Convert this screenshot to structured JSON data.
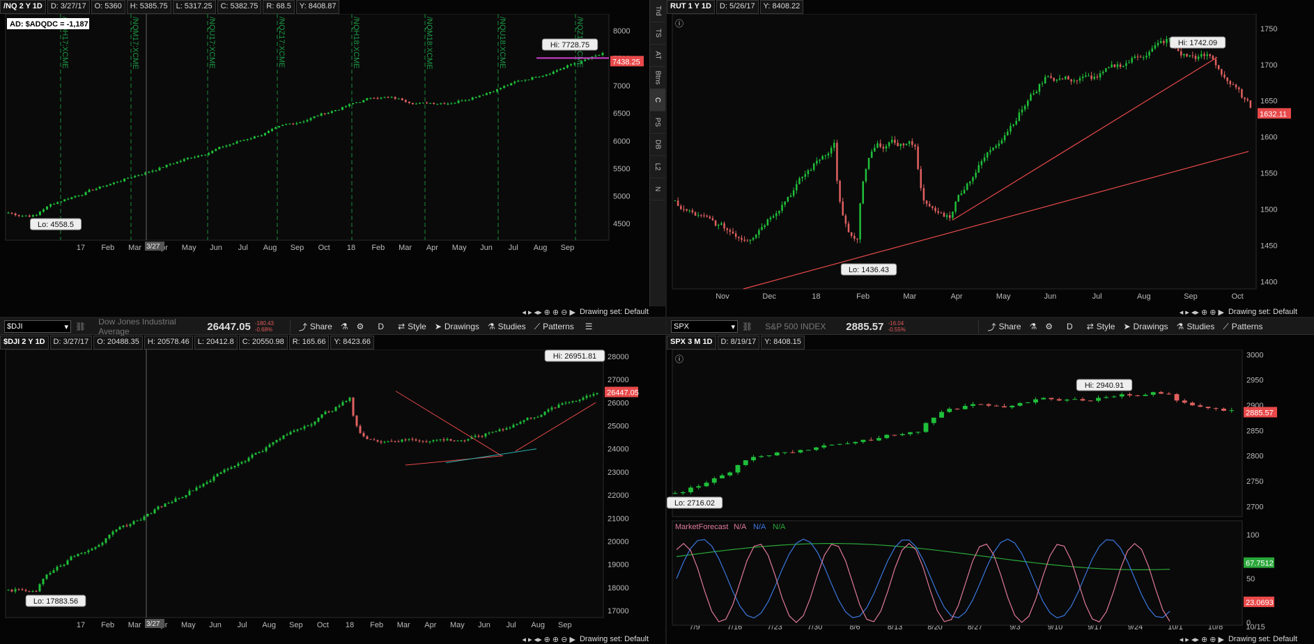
{
  "panels": {
    "nq": {
      "header": {
        "symbol": "/NQ 2 Y 1D",
        "date": "D: 3/27/17",
        "open": "O: 5360",
        "high": "H: 5385.75",
        "low": "L: 5317.25",
        "close": "C: 5382.75",
        "range": "R: 68.5",
        "y": "Y: 8408.87"
      },
      "ad_label": "AD: $ADQDC = -1,187",
      "hi_label": "Hi: 7728.75",
      "lo_label": "Lo: 4558.5",
      "price_tag": "7438.25",
      "cursor_date": "3/27",
      "y_ticks": [
        "8000",
        "7500",
        "7000",
        "6500",
        "6000",
        "5500",
        "5000",
        "4500"
      ],
      "x_ticks": [
        "17",
        "Feb",
        "Mar",
        "Apr",
        "May",
        "Jun",
        "Jul",
        "Aug",
        "Sep",
        "Oct",
        "18",
        "Feb",
        "Mar",
        "Apr",
        "May",
        "Jun",
        "Jul",
        "Aug",
        "Sep"
      ],
      "expiry_labels": [
        "/NQH17:XCME",
        "/NQM17:XCME",
        "/NQU17:XCME",
        "/NQZ17:XCME",
        "/NQH18:XCME",
        "/NQM18:XCME",
        "/NQU18:XCME",
        "/NQZ18:XCME"
      ],
      "drawing_set": "Drawing set: Default"
    },
    "rut": {
      "header": {
        "symbol": "RUT 1 Y 1D",
        "date": "D: 5/26/17",
        "y": "Y: 8408.22"
      },
      "hi_label": "Hi: 1742.09",
      "lo_label": "Lo: 1436.43",
      "price_tag": "1632.11",
      "y_ticks": [
        "1750",
        "1700",
        "1650",
        "1600",
        "1550",
        "1500",
        "1450",
        "1400"
      ],
      "x_ticks": [
        "Nov",
        "Dec",
        "18",
        "Feb",
        "Mar",
        "Apr",
        "May",
        "Jun",
        "Jul",
        "Aug",
        "Sep",
        "Oct"
      ],
      "drawing_set": "Drawing set: Default"
    },
    "dji": {
      "toolbar": {
        "symbol": "$DJI",
        "name": "Dow Jones Industrial Average",
        "price": "26447.05",
        "change": "-180.43",
        "change_pct": "-0.68%",
        "share": "Share",
        "aggregation": "D",
        "style": "Style",
        "drawings": "Drawings",
        "studies": "Studies",
        "patterns": "Patterns"
      },
      "header": {
        "symbol": "$DJI 2 Y 1D",
        "date": "D: 3/27/17",
        "open": "O: 20488.35",
        "high": "H: 20578.46",
        "low": "L: 20412.8",
        "close": "C: 20550.98",
        "range": "R: 165.66",
        "y": "Y: 8423.66"
      },
      "hi_label": "Hi: 26951.81",
      "lo_label": "Lo: 17883.56",
      "price_tag": "26447.05",
      "cursor_date": "3/27",
      "y_ticks": [
        "28000",
        "27000",
        "26000",
        "25000",
        "24000",
        "23000",
        "22000",
        "21000",
        "20000",
        "19000",
        "18000",
        "17000"
      ],
      "x_ticks": [
        "17",
        "Feb",
        "Mar",
        "Apr",
        "May",
        "Jun",
        "Jul",
        "Aug",
        "Sep",
        "Oct",
        "18",
        "Feb",
        "Mar",
        "Apr",
        "May",
        "Jun",
        "Jul",
        "Aug",
        "Sep"
      ],
      "drawing_set": "Drawing set: Default"
    },
    "spx": {
      "toolbar": {
        "symbol": "SPX",
        "name": "S&P 500 INDEX",
        "price": "2885.57",
        "change": "-16.04",
        "change_pct": "-0.55%",
        "share": "Share",
        "aggregation": "D",
        "style": "Style",
        "drawings": "Drawings",
        "studies": "Studies",
        "patterns": "Patterns"
      },
      "header": {
        "symbol": "SPX 3 M 1D",
        "date": "D: 8/19/17",
        "y": "Y: 8408.15"
      },
      "hi_label": "Hi: 2940.91",
      "lo_label": "Lo: 2716.02",
      "price_tag": "2885.57",
      "y_ticks": [
        "3000",
        "2950",
        "2900",
        "2850",
        "2800",
        "2750",
        "2700"
      ],
      "x_ticks": [
        "7/9",
        "7/16",
        "7/23",
        "7/30",
        "8/6",
        "8/13",
        "8/20",
        "8/27",
        "9/3",
        "9/10",
        "9/17",
        "9/24",
        "10/1",
        "10/8",
        "10/15"
      ],
      "study": {
        "name": "MarketForecast",
        "na1": "N/A",
        "na2": "N/A",
        "na3": "N/A",
        "y_ticks": [
          "100",
          "50",
          "0"
        ],
        "tag_green": "67.7512",
        "tag_red": "23.0693"
      },
      "drawing_set": "Drawing set: Default"
    }
  },
  "side_tabs": [
    "Trd",
    "TS",
    "AT",
    "Btns",
    "C",
    "PS",
    "DB",
    "L2",
    "N"
  ],
  "side_tabs_active": "C",
  "colors": {
    "up": "#1fbf3a",
    "down": "#e06060",
    "accent_red": "#e8494a",
    "study_blue": "#3a78e0",
    "study_green": "#2aa83a",
    "study_pink": "#e07a9a",
    "hi_line": "#d040d0"
  },
  "chart_data": [
    {
      "type": "candlestick",
      "title": "/NQ 2 Y 1D",
      "ylim": [
        4200,
        8300
      ],
      "series": [
        {
          "name": "/NQ",
          "start": 4720,
          "end": 7438.25,
          "hi": 7728.75,
          "lo": 4558.5
        }
      ]
    },
    {
      "type": "candlestick",
      "title": "RUT 1 Y 1D",
      "ylim": [
        1390,
        1770
      ],
      "series": [
        {
          "name": "RUT",
          "start": 1515,
          "end": 1632.11,
          "hi": 1742.09,
          "lo": 1436.43
        }
      ]
    },
    {
      "type": "candlestick",
      "title": "$DJI 2 Y 1D",
      "ylim": [
        16700,
        28300
      ],
      "series": [
        {
          "name": "$DJI",
          "start": 18000,
          "end": 26447.05,
          "hi": 26951.81,
          "lo": 17883.56
        }
      ]
    },
    {
      "type": "candlestick",
      "title": "SPX 3 M 1D",
      "ylim": [
        2680,
        3010
      ],
      "series": [
        {
          "name": "SPX",
          "start": 2730,
          "end": 2885.57,
          "hi": 2940.91,
          "lo": 2716.02
        }
      ]
    }
  ]
}
